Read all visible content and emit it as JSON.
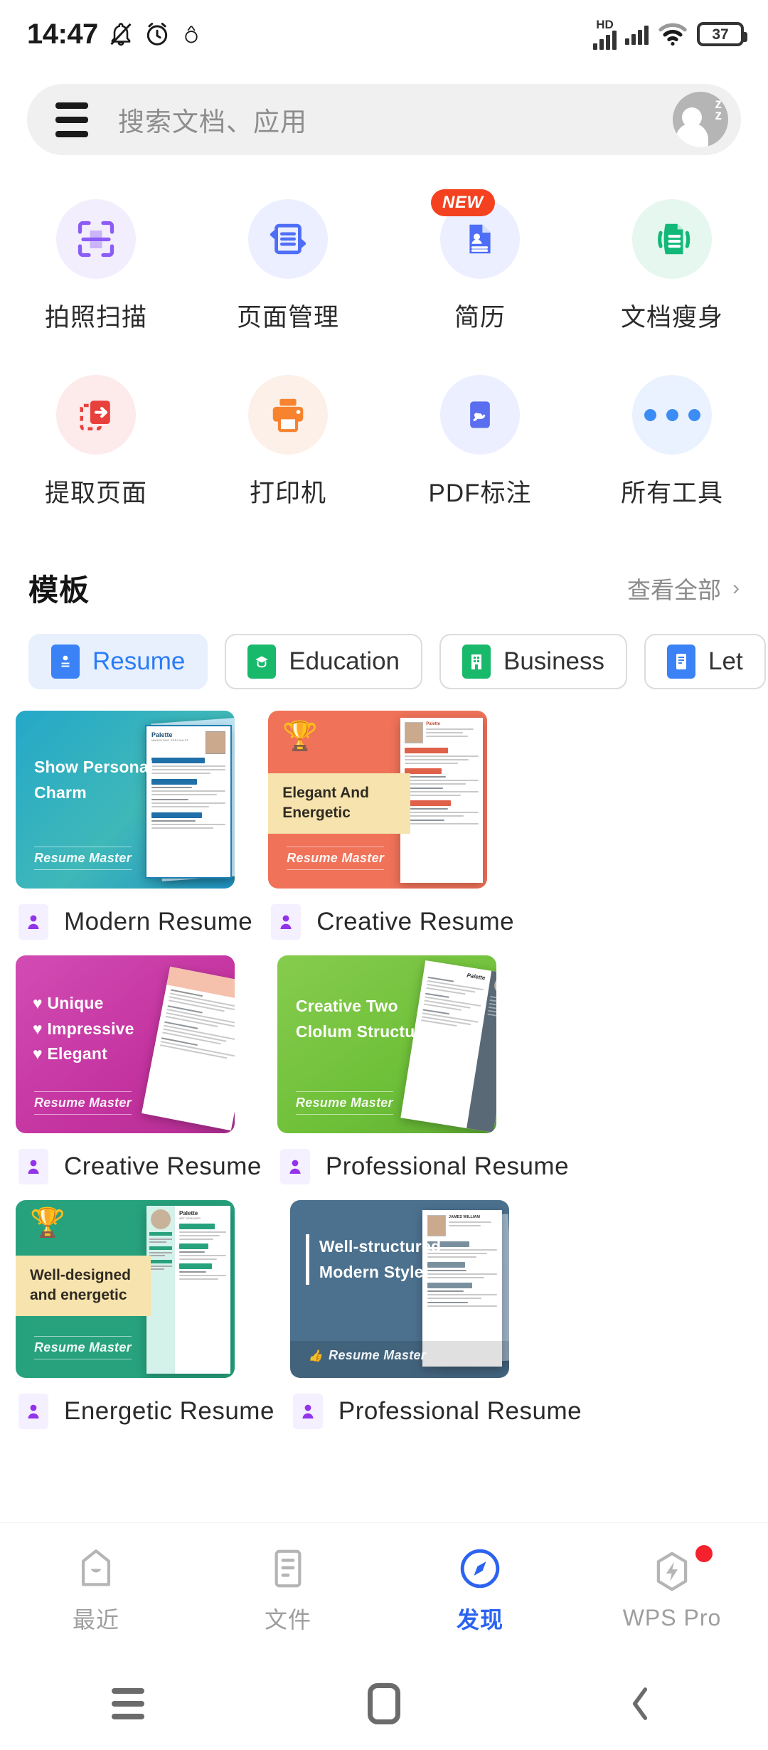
{
  "status_bar": {
    "time": "14:47",
    "icons_left": [
      "mute-icon",
      "alarm-icon",
      "sleep-icon"
    ],
    "network_label": "HD",
    "battery_level": "37",
    "icons_right": [
      "signal-icon",
      "signal-icon-2",
      "wifi-icon",
      "battery-icon"
    ]
  },
  "search": {
    "menu_icon": "hamburger-icon",
    "placeholder": "搜索文档、应用",
    "avatar_icon": "avatar-sleep-icon"
  },
  "tools": {
    "rows": [
      [
        {
          "label": "拍照扫描",
          "icon": "scan-camera-icon",
          "bg": "#f3eefd",
          "fg": "#8b5cf6",
          "badge": ""
        },
        {
          "label": "页面管理",
          "icon": "page-manage-icon",
          "bg": "#ecefff",
          "fg": "#4f6ef7",
          "badge": ""
        },
        {
          "label": "简历",
          "icon": "resume-icon",
          "bg": "#ecefff",
          "fg": "#4f6ef7",
          "badge": "NEW"
        },
        {
          "label": "文档瘦身",
          "icon": "compress-doc-icon",
          "bg": "#e5f7ef",
          "fg": "#11b877",
          "badge": ""
        }
      ],
      [
        {
          "label": "提取页面",
          "icon": "extract-page-icon",
          "bg": "#fdeaea",
          "fg": "#e8413c",
          "badge": ""
        },
        {
          "label": "打印机",
          "icon": "printer-icon",
          "bg": "#fdf0e8",
          "fg": "#f7832f",
          "badge": ""
        },
        {
          "label": "PDF标注",
          "icon": "pdf-annotate-icon",
          "bg": "#ecefff",
          "fg": "#5b6ef0",
          "badge": ""
        },
        {
          "label": "所有工具",
          "icon": "more-dots-icon",
          "bg": "#e9f2fe",
          "fg": "#3c8cf5",
          "badge": ""
        }
      ]
    ]
  },
  "templates": {
    "title": "模板",
    "view_all": "查看全部",
    "view_all_icon": "chevron-right-icon",
    "tabs": [
      {
        "label": "Resume",
        "icon": "resume-tab-icon",
        "color": "#3b82f6",
        "active": true
      },
      {
        "label": "Education",
        "icon": "education-tab-icon",
        "color": "#19b96b",
        "active": false
      },
      {
        "label": "Business",
        "icon": "business-tab-icon",
        "color": "#19b96b",
        "active": false
      },
      {
        "label": "Let",
        "icon": "letter-tab-icon",
        "color": "#3b82f6",
        "active": false
      }
    ],
    "cards": [
      {
        "caption": "Modern Resume",
        "caption_icon": "person-icon",
        "headline": "Show Personal\nCharm",
        "brand": "Resume Master",
        "style": "teal-gradient",
        "accent": "#2ba8c4"
      },
      {
        "caption": "Creative Resume",
        "caption_icon": "person-icon",
        "headline": "Elegant And Energetic",
        "brand": "Resume Master",
        "style": "coral-banner",
        "accent": "#ef7259"
      },
      {
        "caption": "Creative Resume",
        "caption_icon": "person-icon",
        "headline": "♥ Unique\n♥ Impressive\n♥ Elegant",
        "brand": "Resume Master",
        "style": "magenta",
        "accent": "#cc3aa9"
      },
      {
        "caption": "Professional Resume",
        "caption_icon": "person-icon",
        "headline": "Creative Two\nClolum Structure",
        "brand": "Resume Master",
        "style": "green",
        "accent": "#76c442"
      },
      {
        "caption": "Energetic Resume",
        "caption_icon": "person-icon",
        "headline": "Well-designed\nand energetic",
        "brand": "Resume Master",
        "style": "seagreen-banner",
        "accent": "#27a27d"
      },
      {
        "caption": "Professional Resume",
        "caption_icon": "person-icon",
        "headline": "Well-structured\nModern Style",
        "brand": "Resume Master",
        "style": "slate",
        "accent": "#4c718e"
      }
    ],
    "card_titles": {
      "c0_l1": "Show Personal",
      "c0_l2": "Charm",
      "c1_banner": "Elegant And Energetic",
      "c2_l1": "Unique",
      "c2_l2": "Impressive",
      "c2_l3": "Elegant",
      "c3_l1": "Creative Two",
      "c3_l2": "Clolum Structure",
      "c4_banner1": "Well-designed",
      "c4_banner2": "and energetic",
      "c5_l1": "Well-structured",
      "c5_l2": "Modern Style"
    },
    "resume_doc": {
      "name": "Palette",
      "role": "MARKETING SPECIALIST",
      "section_objective": "OBJECTIVE",
      "section_education": "EDUCATION",
      "section_experience": "EXPERIENCE",
      "doc_name2": "JAMES WILLIAM",
      "role2": "ART DESIGNER"
    },
    "brand_label": "Resume Master"
  },
  "bottom_nav": {
    "items": [
      {
        "label": "最近",
        "icon": "recent-icon",
        "active": false,
        "badge": false
      },
      {
        "label": "文件",
        "icon": "files-icon",
        "active": false,
        "badge": false
      },
      {
        "label": "发现",
        "icon": "discover-compass-icon",
        "active": true,
        "badge": false
      },
      {
        "label": "WPS Pro",
        "icon": "wps-pro-icon",
        "active": false,
        "badge": true
      }
    ],
    "active_color": "#2b63f0",
    "inactive_color": "#9e9e9e"
  },
  "system_nav": {
    "recents_icon": "recents-icon",
    "home_icon": "home-icon",
    "back_icon": "back-icon"
  }
}
